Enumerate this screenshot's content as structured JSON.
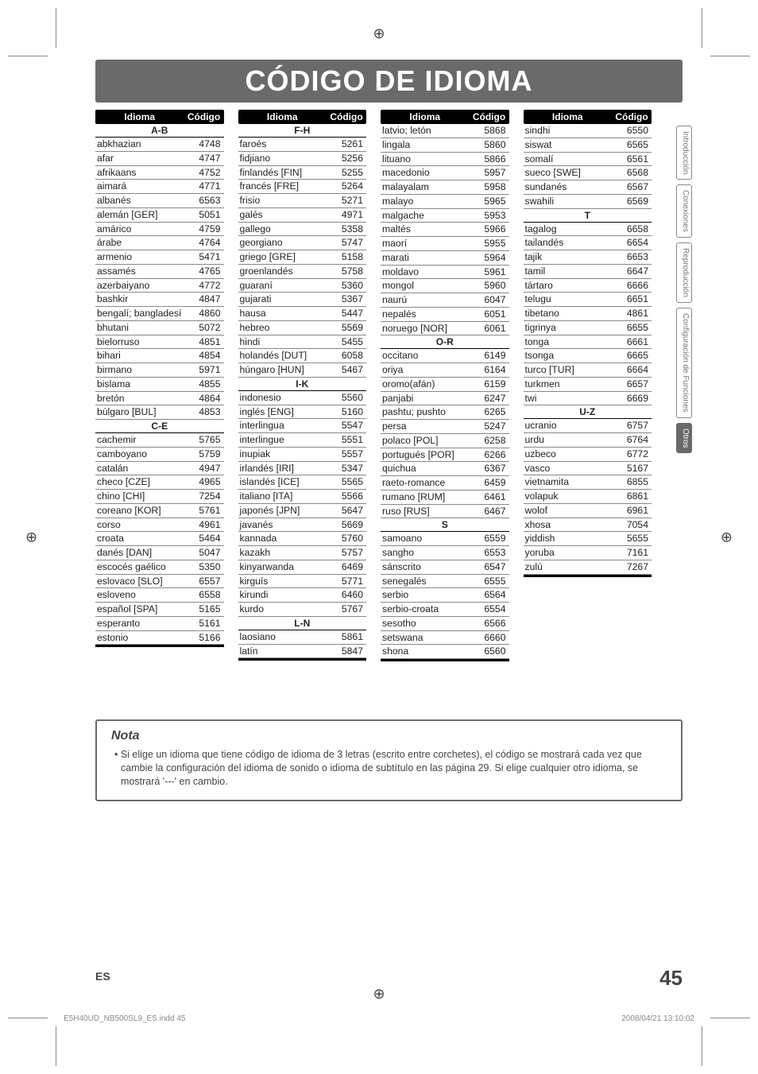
{
  "title": "CÓDIGO DE IDIOMA",
  "headers": {
    "lang": "Idioma",
    "code": "Código"
  },
  "columns": [
    [
      {
        "section": "A-B"
      },
      {
        "l": "abkhazian",
        "c": "4748"
      },
      {
        "l": "afar",
        "c": "4747"
      },
      {
        "l": "afrikaans",
        "c": "4752"
      },
      {
        "l": "aimará",
        "c": "4771"
      },
      {
        "l": "albanés",
        "c": "6563"
      },
      {
        "l": "alemán [GER]",
        "c": "5051"
      },
      {
        "l": "amárico",
        "c": "4759"
      },
      {
        "l": "árabe",
        "c": "4764"
      },
      {
        "l": "armenio",
        "c": "5471"
      },
      {
        "l": "assamés",
        "c": "4765"
      },
      {
        "l": "azerbaiyano",
        "c": "4772"
      },
      {
        "l": "bashkir",
        "c": "4847"
      },
      {
        "l": "bengalí; bangladesí",
        "c": "4860"
      },
      {
        "l": "bhutani",
        "c": "5072"
      },
      {
        "l": "bielorruso",
        "c": "4851"
      },
      {
        "l": "bihari",
        "c": "4854"
      },
      {
        "l": "birmano",
        "c": "5971"
      },
      {
        "l": "bislama",
        "c": "4855"
      },
      {
        "l": "bretón",
        "c": "4864"
      },
      {
        "l": "búlgaro [BUL]",
        "c": "4853"
      },
      {
        "section": "C-E"
      },
      {
        "l": "cachemir",
        "c": "5765"
      },
      {
        "l": "camboyano",
        "c": "5759"
      },
      {
        "l": "catalán",
        "c": "4947"
      },
      {
        "l": "checo [CZE]",
        "c": "4965"
      },
      {
        "l": "chino [CHI]",
        "c": "7254"
      },
      {
        "l": "coreano [KOR]",
        "c": "5761"
      },
      {
        "l": "corso",
        "c": "4961"
      },
      {
        "l": "croata",
        "c": "5464"
      },
      {
        "l": "danés [DAN]",
        "c": "5047"
      },
      {
        "l": "escocés gaélico",
        "c": "5350"
      },
      {
        "l": "eslovaco [SLO]",
        "c": "6557"
      },
      {
        "l": "esloveno",
        "c": "6558"
      },
      {
        "l": "español [SPA]",
        "c": "5165"
      },
      {
        "l": "esperanto",
        "c": "5161"
      },
      {
        "l": "estonio",
        "c": "5166"
      }
    ],
    [
      {
        "section": "F-H"
      },
      {
        "l": "faroés",
        "c": "5261"
      },
      {
        "l": "fidjiano",
        "c": "5256"
      },
      {
        "l": "finlandés [FIN]",
        "c": "5255"
      },
      {
        "l": "francés [FRE]",
        "c": "5264"
      },
      {
        "l": "frisio",
        "c": "5271"
      },
      {
        "l": "galés",
        "c": "4971"
      },
      {
        "l": "gallego",
        "c": "5358"
      },
      {
        "l": "georgiano",
        "c": "5747"
      },
      {
        "l": "griego [GRE]",
        "c": "5158"
      },
      {
        "l": "groenlandés",
        "c": "5758"
      },
      {
        "l": "guaraní",
        "c": "5360"
      },
      {
        "l": "gujarati",
        "c": "5367"
      },
      {
        "l": "hausa",
        "c": "5447"
      },
      {
        "l": "hebreo",
        "c": "5569"
      },
      {
        "l": "hindi",
        "c": "5455"
      },
      {
        "l": "holandés [DUT]",
        "c": "6058"
      },
      {
        "l": "húngaro [HUN]",
        "c": "5467"
      },
      {
        "section": "I-K"
      },
      {
        "l": "indonesio",
        "c": "5560"
      },
      {
        "l": "inglés [ENG]",
        "c": "5160"
      },
      {
        "l": "interlingua",
        "c": "5547"
      },
      {
        "l": "interlingue",
        "c": "5551"
      },
      {
        "l": "inupiak",
        "c": "5557"
      },
      {
        "l": "irlandés [IRI]",
        "c": "5347"
      },
      {
        "l": "islandés [ICE]",
        "c": "5565"
      },
      {
        "l": "italiano [ITA]",
        "c": "5566"
      },
      {
        "l": "japonés [JPN]",
        "c": "5647"
      },
      {
        "l": "javanés",
        "c": "5669"
      },
      {
        "l": "kannada",
        "c": "5760"
      },
      {
        "l": "kazakh",
        "c": "5757"
      },
      {
        "l": "kinyarwanda",
        "c": "6469"
      },
      {
        "l": "kirguís",
        "c": "5771"
      },
      {
        "l": "kirundi",
        "c": "6460"
      },
      {
        "l": "kurdo",
        "c": "5767"
      },
      {
        "section": "L-N"
      },
      {
        "l": "laosiano",
        "c": "5861"
      },
      {
        "l": "latín",
        "c": "5847"
      }
    ],
    [
      {
        "l": "latvio; letón",
        "c": "5868"
      },
      {
        "l": "lingala",
        "c": "5860"
      },
      {
        "l": "lituano",
        "c": "5866"
      },
      {
        "l": "macedonio",
        "c": "5957"
      },
      {
        "l": "malayalam",
        "c": "5958"
      },
      {
        "l": "malayo",
        "c": "5965"
      },
      {
        "l": "malgache",
        "c": "5953"
      },
      {
        "l": "maltés",
        "c": "5966"
      },
      {
        "l": "maorí",
        "c": "5955"
      },
      {
        "l": "marati",
        "c": "5964"
      },
      {
        "l": "moldavo",
        "c": "5961"
      },
      {
        "l": "mongol",
        "c": "5960"
      },
      {
        "l": "naurú",
        "c": "6047"
      },
      {
        "l": "nepalés",
        "c": "6051"
      },
      {
        "l": "noruego [NOR]",
        "c": "6061"
      },
      {
        "section": "O-R"
      },
      {
        "l": "occitano",
        "c": "6149"
      },
      {
        "l": "oriya",
        "c": "6164"
      },
      {
        "l": "oromo(afán)",
        "c": "6159"
      },
      {
        "l": "panjabi",
        "c": "6247"
      },
      {
        "l": "pashtu; pushto",
        "c": "6265"
      },
      {
        "l": "persa",
        "c": "5247"
      },
      {
        "l": "polaco [POL]",
        "c": "6258"
      },
      {
        "l": "portugués [POR]",
        "c": "6266"
      },
      {
        "l": "quichua",
        "c": "6367"
      },
      {
        "l": "raeto-romance",
        "c": "6459"
      },
      {
        "l": "rumano [RUM]",
        "c": "6461"
      },
      {
        "l": "ruso [RUS]",
        "c": "6467"
      },
      {
        "section": "S"
      },
      {
        "l": "samoano",
        "c": "6559"
      },
      {
        "l": "sangho",
        "c": "6553"
      },
      {
        "l": "sánscrito",
        "c": "6547"
      },
      {
        "l": "senegalés",
        "c": "6555"
      },
      {
        "l": "serbio",
        "c": "6564"
      },
      {
        "l": "serbio-croata",
        "c": "6554"
      },
      {
        "l": "sesotho",
        "c": "6566"
      },
      {
        "l": "setswana",
        "c": "6660"
      },
      {
        "l": "shona",
        "c": "6560"
      }
    ],
    [
      {
        "l": "sindhi",
        "c": "6550"
      },
      {
        "l": "siswat",
        "c": "6565"
      },
      {
        "l": "somalí",
        "c": "6561"
      },
      {
        "l": "sueco [SWE]",
        "c": "6568"
      },
      {
        "l": "sundanés",
        "c": "6567"
      },
      {
        "l": "swahili",
        "c": "6569"
      },
      {
        "section": "T"
      },
      {
        "l": "tagalog",
        "c": "6658"
      },
      {
        "l": "tailandés",
        "c": "6654"
      },
      {
        "l": "tajik",
        "c": "6653"
      },
      {
        "l": "tamil",
        "c": "6647"
      },
      {
        "l": "tártaro",
        "c": "6666"
      },
      {
        "l": "telugu",
        "c": "6651"
      },
      {
        "l": "tibetano",
        "c": "4861"
      },
      {
        "l": "tigrinya",
        "c": "6655"
      },
      {
        "l": "tonga",
        "c": "6661"
      },
      {
        "l": "tsonga",
        "c": "6665"
      },
      {
        "l": "turco [TUR]",
        "c": "6664"
      },
      {
        "l": "turkmen",
        "c": "6657"
      },
      {
        "l": "twi",
        "c": "6669"
      },
      {
        "section": "U-Z"
      },
      {
        "l": "ucranio",
        "c": "6757"
      },
      {
        "l": "urdu",
        "c": "6764"
      },
      {
        "l": "uzbeco",
        "c": "6772"
      },
      {
        "l": "vasco",
        "c": "5167"
      },
      {
        "l": "vietnamita",
        "c": "6855"
      },
      {
        "l": "volapuk",
        "c": "6861"
      },
      {
        "l": "wolof",
        "c": "6961"
      },
      {
        "l": "xhosa",
        "c": "7054"
      },
      {
        "l": "yiddish",
        "c": "5655"
      },
      {
        "l": "yoruba",
        "c": "7161"
      },
      {
        "l": "zulú",
        "c": "7267"
      }
    ]
  ],
  "sidebar": {
    "tabs": [
      "Introducción",
      "Conexiones",
      "Reproducción",
      "Configuración de Funciones",
      "Otros"
    ],
    "active_index": 4
  },
  "nota": {
    "title": "Nota",
    "body": "• Si elige un idioma que tiene código de idioma de 3 letras (escrito entre corchetes), el código se mostrará cada vez que cambie la configuración del idioma de sonido o idioma de subtítulo en las página 29. Si elige cualquier otro idioma, se mostrará '---' en cambio."
  },
  "footer": {
    "left": "ES",
    "right": "45"
  },
  "imprint": {
    "left": "E5H40UD_NB500SL9_ES.indd   45",
    "right": "2008/04/21   13:10:02"
  }
}
